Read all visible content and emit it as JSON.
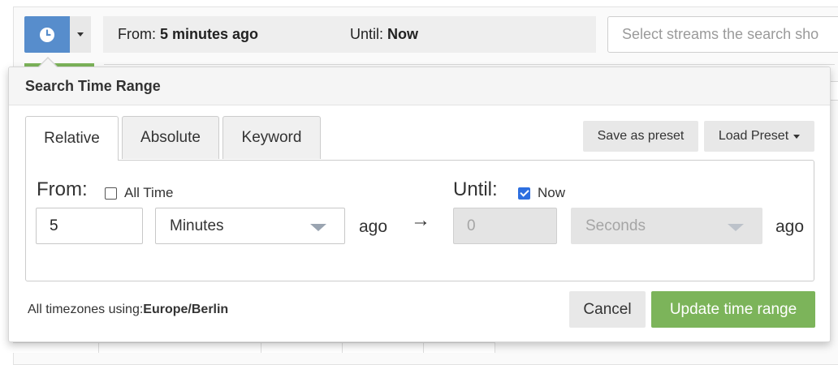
{
  "toolbar": {
    "from_prefix": "From:",
    "from_value": "5 minutes ago",
    "until_prefix": "Until:",
    "until_value": "Now",
    "stream_placeholder": "Select streams the search sho"
  },
  "popover": {
    "title": "Search Time Range",
    "tabs": [
      "Relative",
      "Absolute",
      "Keyword"
    ],
    "active_tab": "Relative",
    "save_preset_label": "Save as preset",
    "load_preset_label": "Load Preset",
    "from": {
      "label": "From:",
      "all_time_label": "All Time",
      "all_time_checked": false,
      "value": "5",
      "unit": "Minutes",
      "suffix": "ago"
    },
    "arrow": "→",
    "until": {
      "label": "Until:",
      "now_label": "Now",
      "now_checked": true,
      "value": "0",
      "unit": "Seconds",
      "suffix": "ago"
    },
    "timezone_prefix": "All timezones using:",
    "timezone_value": "Europe/Berlin",
    "cancel_label": "Cancel",
    "update_label": "Update time range"
  },
  "colors": {
    "accent_blue": "#578dcc",
    "success_green": "#7cb45a",
    "checkbox_blue": "#2d6fe0"
  }
}
